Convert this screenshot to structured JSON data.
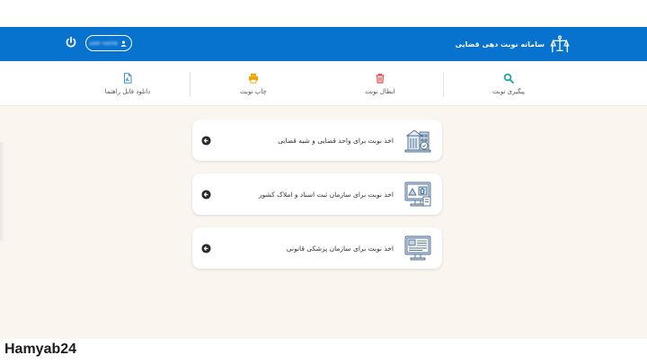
{
  "header": {
    "title": "سامانه نوبت دهی قضایی",
    "user_name": "user name",
    "colors": {
      "primary": "#0872cf"
    }
  },
  "toolbar": {
    "items": [
      {
        "label": "پیگیری نوبت",
        "icon": "search-icon",
        "color": "#1aa6a0"
      },
      {
        "label": "ابطال نوبت",
        "icon": "trash-icon",
        "color": "#e04848"
      },
      {
        "label": "چاپ نوبت",
        "icon": "printer-icon",
        "color": "#f0a500"
      },
      {
        "label": "دانلود فایل راهنما",
        "icon": "document-icon",
        "color": "#3a8fd9"
      }
    ]
  },
  "services": [
    {
      "label": "اخذ نوبت برای واحد قضایی و شبه قضایی",
      "icon": "court-building-icon"
    },
    {
      "label": "اخذ نوبت برای سازمان ثبت اسناد و املاک کشور",
      "icon": "registry-monitor-icon"
    },
    {
      "label": "اخذ نوبت برای سازمان پزشکی قانونی",
      "icon": "medical-monitor-icon"
    }
  ],
  "watermark": "Hamyab24"
}
